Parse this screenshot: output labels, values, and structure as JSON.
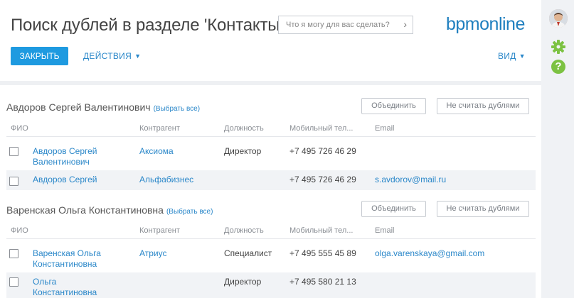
{
  "header": {
    "title": "Поиск дублей в разделе 'Контакты'",
    "search_placeholder": "Что я могу для вас сделать?",
    "logo_left": "bpm",
    "logo_right": "online"
  },
  "toolbar": {
    "close_label": "ЗАКРЫТЬ",
    "actions_label": "ДЕЙСТВИЯ",
    "view_label": "ВИД"
  },
  "columns": [
    "ФИО",
    "Контрагент",
    "Должность",
    "Мобильный тел...",
    "Email"
  ],
  "groups": [
    {
      "title": "Авдоров Сергей Валентинович",
      "select_all": "(Выбрать все)",
      "merge_label": "Объединить",
      "not_dup_label": "Не считать дублями",
      "rows": [
        {
          "name": "Авдоров Сергей Валентинович",
          "account": "Аксиома",
          "job": "Директор",
          "phone": "+7 495 726 46 29",
          "email": ""
        },
        {
          "name": "Авдоров Сергей",
          "account": "Альфабизнес",
          "job": "",
          "phone": "+7 495 726 46 29",
          "email": "s.avdorov@mail.ru"
        }
      ]
    },
    {
      "title": "Варенская Ольга Константиновна",
      "select_all": "(Выбрать все)",
      "merge_label": "Объединить",
      "not_dup_label": "Не считать дублями",
      "rows": [
        {
          "name": "Варенская Ольга Константиновна",
          "account": "Атриус",
          "job": "Специалист",
          "phone": "+7 495 555 45 89",
          "email": "olga.varenskaya@gmail.com"
        },
        {
          "name": "Ольга Константиновна",
          "account": "",
          "job": "Директор",
          "phone": "+7 495 580 21 13",
          "email": ""
        }
      ]
    }
  ],
  "colors": {
    "accent": "#1e9ae0",
    "link": "#2a87c9",
    "logo": "#1f7fbf",
    "logo_dot": "#e8533f",
    "help": "#7cc242",
    "gear": "#7cc242"
  },
  "sidebar_icons": [
    "avatar",
    "gear-icon",
    "help-icon"
  ]
}
